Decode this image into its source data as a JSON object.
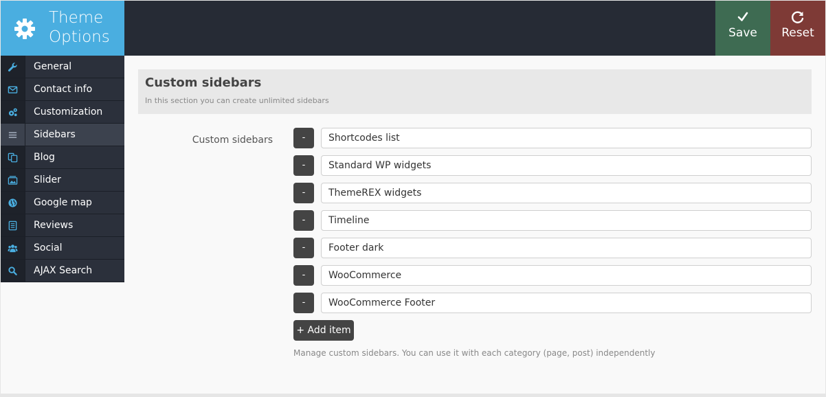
{
  "brand": {
    "title": "Theme Options",
    "color": "#4aaee0"
  },
  "header": {
    "save_label": "Save",
    "reset_label": "Reset",
    "save_color": "#3e6b52",
    "reset_color": "#7e3a36"
  },
  "sidebar": {
    "items": [
      {
        "label": "General",
        "icon": "wrench-icon"
      },
      {
        "label": "Contact info",
        "icon": "envelope-icon"
      },
      {
        "label": "Customization",
        "icon": "gears-icon"
      },
      {
        "label": "Sidebars",
        "icon": "list-icon",
        "active": true
      },
      {
        "label": "Blog",
        "icon": "copy-icon"
      },
      {
        "label": "Slider",
        "icon": "image-icon"
      },
      {
        "label": "Google map",
        "icon": "globe-icon"
      },
      {
        "label": "Reviews",
        "icon": "document-icon"
      },
      {
        "label": "Social",
        "icon": "users-icon"
      },
      {
        "label": "AJAX Search",
        "icon": "search-icon"
      }
    ]
  },
  "section": {
    "title": "Custom sidebars",
    "description": "In this section you can create unlimited sidebars"
  },
  "field": {
    "label": "Custom sidebars",
    "remove_label": "-",
    "items": [
      "Shortcodes list",
      "Standard WP widgets",
      "ThemeREX widgets",
      "Timeline",
      "Footer dark",
      "WooCommerce",
      "WooCommerce Footer"
    ],
    "add_label": "+ Add item",
    "hint": "Manage custom sidebars. You can use it with each category (page, post) independently"
  }
}
